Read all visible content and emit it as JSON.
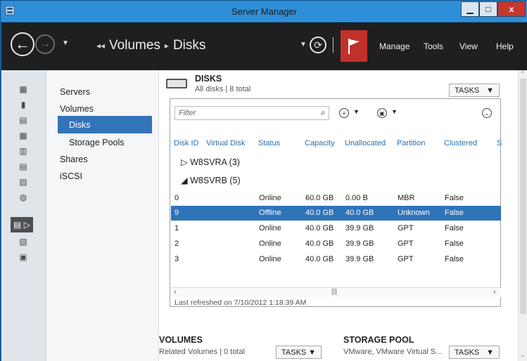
{
  "window": {
    "title": "Server Manager",
    "controls": {
      "minimize": "▁",
      "maximize": "□",
      "close": "x"
    }
  },
  "toolbar": {
    "breadcrumb": [
      "Volumes",
      "Disks"
    ],
    "menus": [
      "Manage",
      "Tools",
      "View",
      "Help"
    ]
  },
  "rail_icons": [
    "dashboard-icon",
    "local-server-icon",
    "all-servers-icon",
    "ad-icon",
    "dhcp-icon",
    "dns-icon",
    "file-services-icon",
    "iis-icon",
    "file-storage-icon",
    "hyper-v-icon",
    "print-icon"
  ],
  "subnav": {
    "items": [
      {
        "label": "Servers",
        "child": false,
        "selected": false
      },
      {
        "label": "Volumes",
        "child": false,
        "selected": false
      },
      {
        "label": "Disks",
        "child": true,
        "selected": true
      },
      {
        "label": "Storage Pools",
        "child": true,
        "selected": false
      },
      {
        "label": "Shares",
        "child": false,
        "selected": false
      },
      {
        "label": "iSCSI",
        "child": false,
        "selected": false
      }
    ]
  },
  "disks": {
    "title": "DISKS",
    "subtitle": "All disks | 8 total",
    "tasks_label": "TASKS",
    "filter_placeholder": "Filter",
    "columns": [
      "Disk ID",
      "Virtual Disk",
      "Status",
      "Capacity",
      "Unallocated",
      "Partition",
      "Clustered",
      "S"
    ],
    "groups": [
      {
        "label": "W8SVRA (3)",
        "expanded": false
      },
      {
        "label": "W8SVRB (5)",
        "expanded": true
      }
    ],
    "rows": [
      {
        "id": "0",
        "virtual_disk": "",
        "status": "Online",
        "capacity": "60.0 GB",
        "unallocated": "0.00 B",
        "partition": "MBR",
        "clustered": "False",
        "selected": false
      },
      {
        "id": "9",
        "virtual_disk": "",
        "status": "Offline",
        "capacity": "40.0 GB",
        "unallocated": "40.0 GB",
        "partition": "Unknown",
        "clustered": "False",
        "selected": true
      },
      {
        "id": "1",
        "virtual_disk": "",
        "status": "Online",
        "capacity": "40.0 GB",
        "unallocated": "39.9 GB",
        "partition": "GPT",
        "clustered": "False",
        "selected": false
      },
      {
        "id": "2",
        "virtual_disk": "",
        "status": "Online",
        "capacity": "40.0 GB",
        "unallocated": "39.9 GB",
        "partition": "GPT",
        "clustered": "False",
        "selected": false
      },
      {
        "id": "3",
        "virtual_disk": "",
        "status": "Online",
        "capacity": "40.0 GB",
        "unallocated": "39.9 GB",
        "partition": "GPT",
        "clustered": "False",
        "selected": false
      }
    ],
    "last_refreshed": "Last refreshed on 7/10/2012 1:18:39 AM"
  },
  "volumes": {
    "title": "VOLUMES",
    "subtitle": "Related Volumes | 0 total",
    "tasks_label": "TASKS"
  },
  "storage_pool": {
    "title": "STORAGE POOL",
    "subtitle": "VMware, VMware Virtual S...",
    "tasks_label": "TASKS"
  },
  "colors": {
    "accent": "#3374b8",
    "selected_row": "#2f73b9",
    "toolbar_bg": "#1f1f1f",
    "notification_flag": "#c0312a"
  }
}
